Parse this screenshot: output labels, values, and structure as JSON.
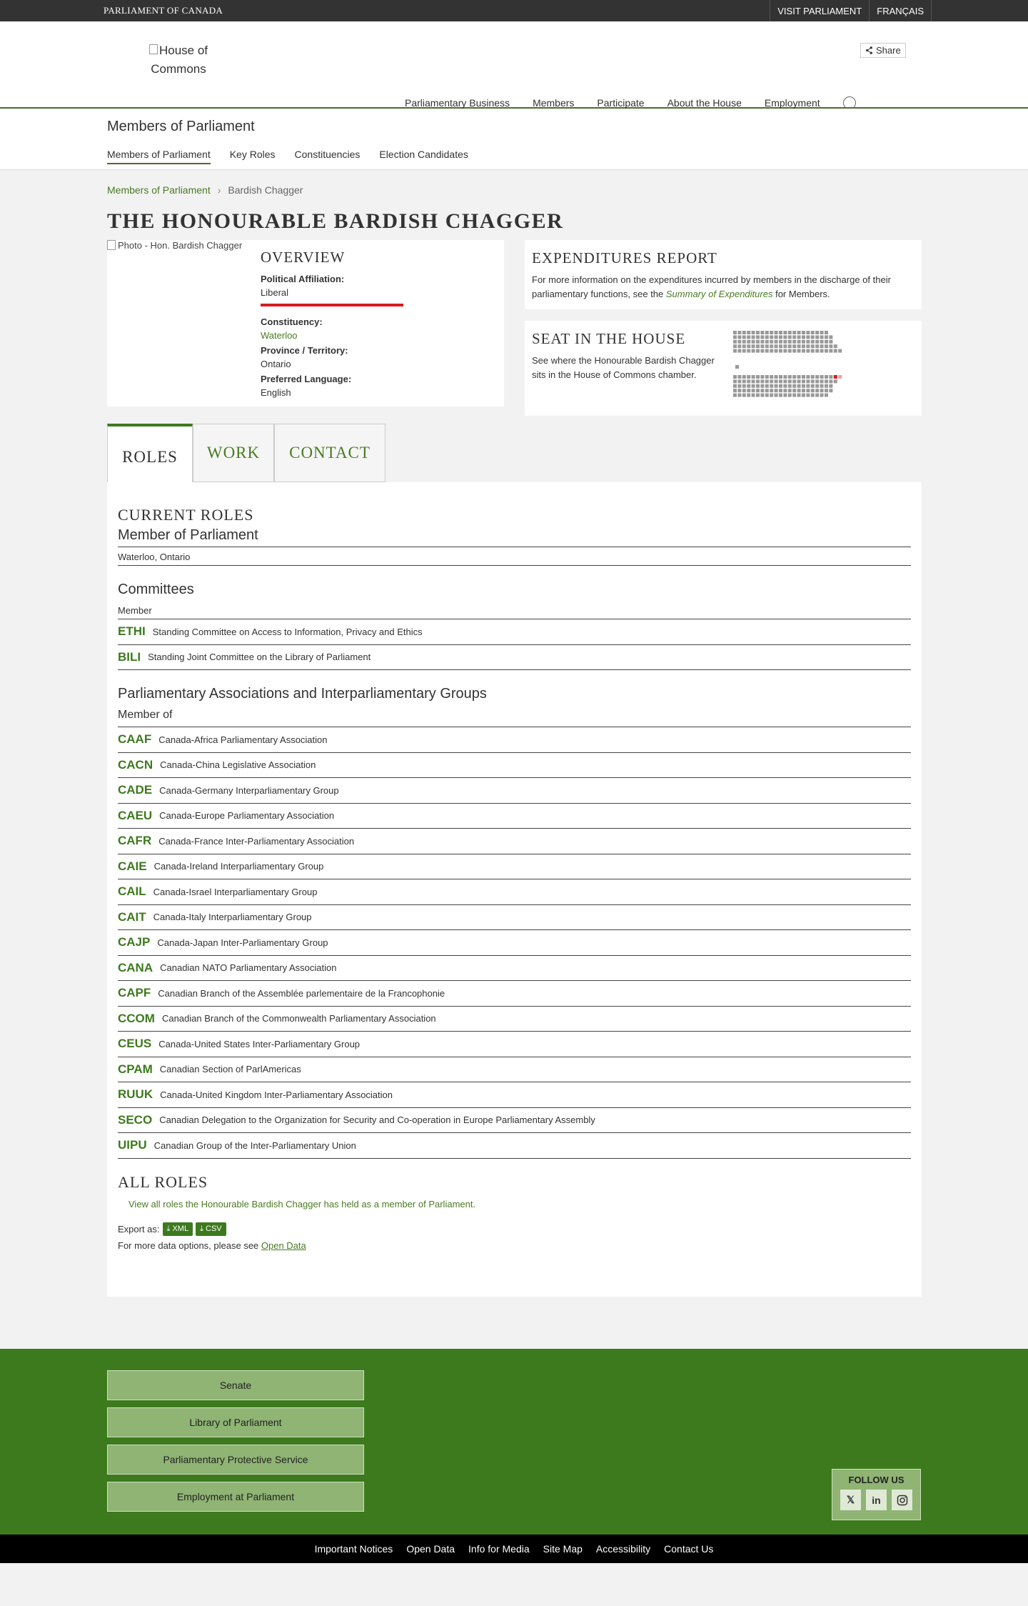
{
  "topbar": {
    "brand": "PARLIAMENT OF CANADA",
    "visit": "VISIT PARLIAMENT",
    "lang": "FRANÇAIS"
  },
  "header": {
    "logo_alt": "House of Commons",
    "share": "Share",
    "nav": [
      "Parliamentary Business",
      "Members",
      "Participate",
      "About the House",
      "Employment"
    ]
  },
  "subheader": {
    "title": "Members of Parliament",
    "nav": [
      "Members of Parliament",
      "Key Roles",
      "Constituencies",
      "Election Candidates"
    ]
  },
  "breadcrumb": [
    "Members of Parliament",
    "Bardish Chagger"
  ],
  "page_title": "THE HONOURABLE BARDISH CHAGGER",
  "overview": {
    "photo_alt": "Photo - Hon. Bardish Chagger",
    "heading": "OVERVIEW",
    "affiliation_label": "Political Affiliation:",
    "affiliation": "Liberal",
    "party_color": "#d71920",
    "constituency_label": "Constituency:",
    "constituency": "Waterloo",
    "province_label": "Province / Territory:",
    "province": "Ontario",
    "language_label": "Preferred Language:",
    "language": "English"
  },
  "expenditures": {
    "heading": "EXPENDITURES REPORT",
    "text_before": "For more information on the expenditures incurred by members in the discharge of their parliamentary functions, see the ",
    "link": "Summary of Expenditures",
    "text_after": " for Members."
  },
  "seat": {
    "heading": "SEAT IN THE HOUSE",
    "text": "See where the Honourable Bardish Chagger sits in the House of Commons chamber."
  },
  "tabs": [
    "ROLES",
    "WORK",
    "CONTACT"
  ],
  "roles": {
    "current_heading": "CURRENT ROLES",
    "mp_title": "Member of Parliament",
    "mp_location": "Waterloo, Ontario",
    "committees_heading": "Committees",
    "committees_sub": "Member",
    "committees": [
      {
        "abbr": "ETHI",
        "name": "Standing Committee on Access to Information, Privacy and Ethics"
      },
      {
        "abbr": "BILI",
        "name": "Standing Joint Committee on the Library of Parliament"
      }
    ],
    "assoc_heading": "Parliamentary Associations and Interparliamentary Groups",
    "assoc_sub": "Member of",
    "associations": [
      {
        "abbr": "CAAF",
        "name": "Canada-Africa Parliamentary Association"
      },
      {
        "abbr": "CACN",
        "name": "Canada-China Legislative Association"
      },
      {
        "abbr": "CADE",
        "name": "Canada-Germany Interparliamentary Group"
      },
      {
        "abbr": "CAEU",
        "name": "Canada-Europe Parliamentary Association"
      },
      {
        "abbr": "CAFR",
        "name": "Canada-France Inter-Parliamentary Association"
      },
      {
        "abbr": "CAIE",
        "name": "Canada-Ireland Interparliamentary Group"
      },
      {
        "abbr": "CAIL",
        "name": "Canada-Israel Interparliamentary Group"
      },
      {
        "abbr": "CAIT",
        "name": "Canada-Italy Interparliamentary Group"
      },
      {
        "abbr": "CAJP",
        "name": "Canada-Japan Inter-Parliamentary Group"
      },
      {
        "abbr": "CANA",
        "name": "Canadian NATO Parliamentary Association"
      },
      {
        "abbr": "CAPF",
        "name": "Canadian Branch of the Assemblée parlementaire de la Francophonie"
      },
      {
        "abbr": "CCOM",
        "name": "Canadian Branch of the Commonwealth Parliamentary Association"
      },
      {
        "abbr": "CEUS",
        "name": "Canada-United States Inter-Parliamentary Group"
      },
      {
        "abbr": "CPAM",
        "name": "Canadian Section of ParlAmericas"
      },
      {
        "abbr": "RUUK",
        "name": "Canada-United Kingdom Inter-Parliamentary Association"
      },
      {
        "abbr": "SECO",
        "name": "Canadian Delegation to the Organization for Security and Co-operation in Europe Parliamentary Assembly"
      },
      {
        "abbr": "UIPU",
        "name": "Canadian Group of the Inter-Parliamentary Union"
      }
    ],
    "all_heading": "ALL ROLES",
    "view_all": "View all roles the Honourable Bardish Chagger has held as a member of Parliament.",
    "export_label": "Export as:",
    "export_xml": "XML",
    "export_csv": "CSV",
    "more_text": "For more data options, please see ",
    "more_link": "Open Data"
  },
  "footer": {
    "links": [
      "Senate",
      "Library of Parliament",
      "Parliamentary Protective Service",
      "Employment at Parliament"
    ],
    "follow": "FOLLOW US",
    "social_icons": [
      "x-icon",
      "linkedin-icon",
      "instagram-icon"
    ],
    "bottom_links": [
      "Important Notices",
      "Open Data",
      "Info for Media",
      "Site Map",
      "Accessibility",
      "Contact Us"
    ]
  }
}
